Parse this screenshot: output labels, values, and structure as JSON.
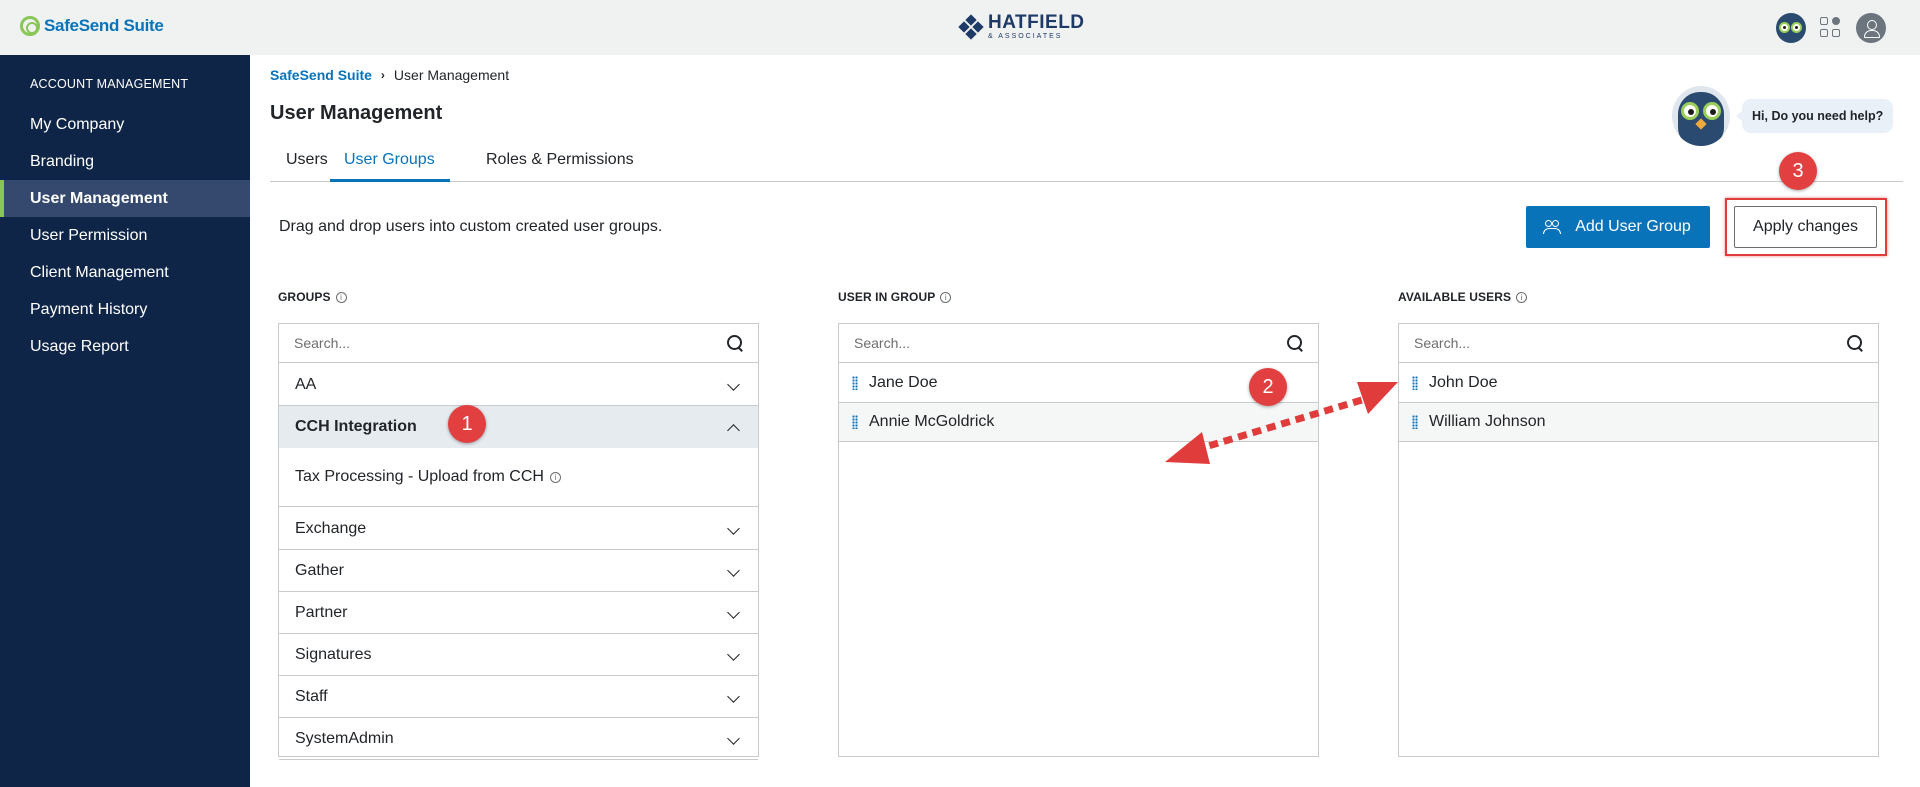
{
  "topbar": {
    "brand": "SafeSend Suite",
    "company_name": "HATFIELD",
    "company_sub": "& ASSOCIATES"
  },
  "sidebar": {
    "section_title": "ACCOUNT MANAGEMENT",
    "items": [
      {
        "label": "My Company"
      },
      {
        "label": "Branding"
      },
      {
        "label": "User Management",
        "active": true
      },
      {
        "label": "User Permission"
      },
      {
        "label": "Client Management"
      },
      {
        "label": "Payment History"
      },
      {
        "label": "Usage Report"
      }
    ]
  },
  "breadcrumb": {
    "root": "SafeSend Suite",
    "separator": "›",
    "current": "User Management"
  },
  "page": {
    "title": "User Management",
    "tabs": [
      {
        "label": "Users"
      },
      {
        "label": "User Groups",
        "active": true
      },
      {
        "label": "Roles & Permissions"
      }
    ],
    "instructions": "Drag and drop users into custom created user groups.",
    "add_group_button": "Add User Group",
    "apply_button": "Apply changes",
    "help_text": "Hi, Do you need help?"
  },
  "groups": {
    "label": "GROUPS",
    "search_placeholder": "Search...",
    "rows": [
      {
        "label": "AA"
      },
      {
        "label": "CCH Integration",
        "expanded": true,
        "sub": "Tax Processing - Upload from CCH"
      },
      {
        "label": "Exchange"
      },
      {
        "label": "Gather"
      },
      {
        "label": "Partner"
      },
      {
        "label": "Signatures"
      },
      {
        "label": "Staff"
      },
      {
        "label": "SystemAdmin"
      }
    ]
  },
  "users_in_group": {
    "label": "USER IN GROUP",
    "search_placeholder": "Search...",
    "users": [
      "Jane Doe",
      "Annie McGoldrick"
    ]
  },
  "available_users": {
    "label": "AVAILABLE USERS",
    "search_placeholder": "Search...",
    "users": [
      "John Doe",
      "William Johnson"
    ]
  },
  "annotations": {
    "badges": [
      "1",
      "2",
      "3"
    ],
    "badge_color": "#e24040",
    "arrow_color": "#e03c3c"
  },
  "colors": {
    "primary": "#0973ba",
    "sidebar_bg": "#0f2547",
    "accent_green": "#88c656",
    "highlight": "#e03c3c"
  }
}
